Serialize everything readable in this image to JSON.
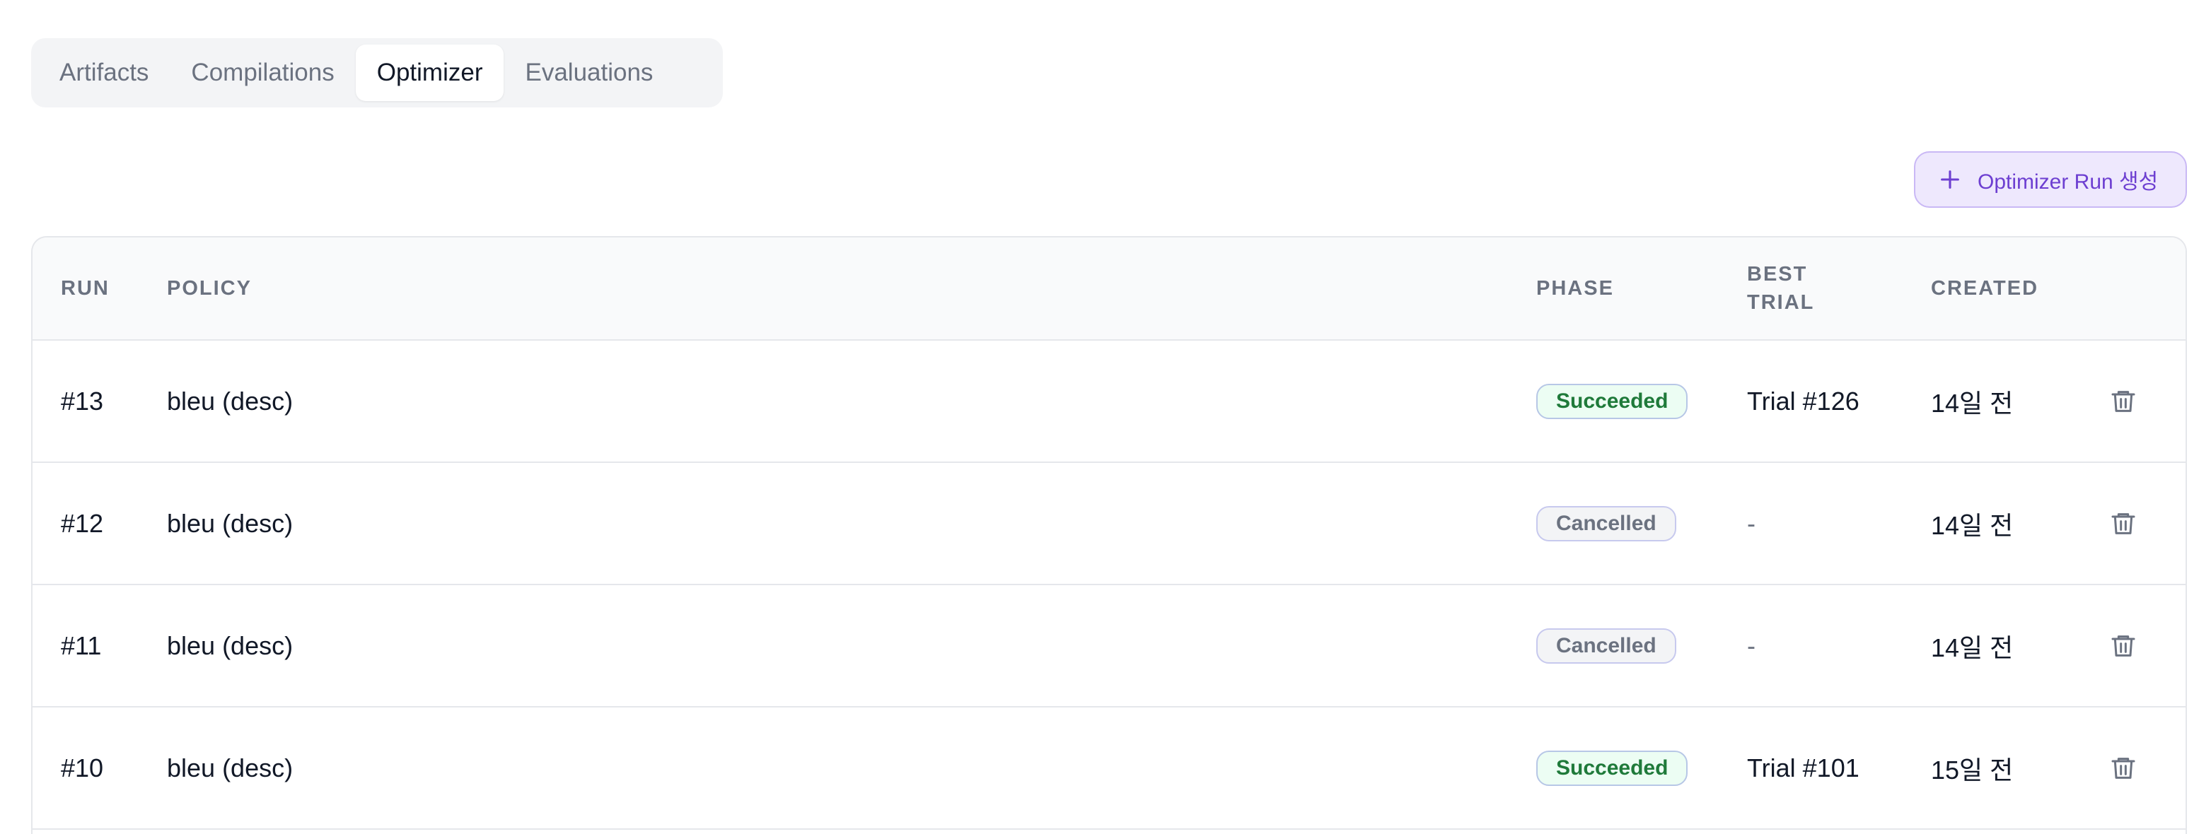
{
  "tabs": [
    {
      "label": "Artifacts",
      "active": false
    },
    {
      "label": "Compilations",
      "active": false
    },
    {
      "label": "Optimizer",
      "active": true
    },
    {
      "label": "Evaluations",
      "active": false
    }
  ],
  "toolbar": {
    "create_label": "Optimizer Run 생성",
    "create_icon": "plus-icon"
  },
  "table": {
    "headers": {
      "run": "RUN",
      "policy": "POLICY",
      "phase": "PHASE",
      "best_trial_line1": "BEST",
      "best_trial_line2": "TRIAL",
      "created": "CREATED"
    },
    "rows": [
      {
        "run": "#13",
        "policy": "bleu (desc)",
        "phase": "Succeeded",
        "best_trial": "Trial #126",
        "created": "14일 전"
      },
      {
        "run": "#12",
        "policy": "bleu (desc)",
        "phase": "Cancelled",
        "best_trial": "-",
        "created": "14일 전"
      },
      {
        "run": "#11",
        "policy": "bleu (desc)",
        "phase": "Cancelled",
        "best_trial": "-",
        "created": "14일 전"
      },
      {
        "run": "#10",
        "policy": "bleu (desc)",
        "phase": "Succeeded",
        "best_trial": "Trial #101",
        "created": "15일 전"
      }
    ],
    "row_action_icon": "trash-icon"
  },
  "colors": {
    "accent": "#6d3fd1",
    "success": "#1f7a3a",
    "muted": "#6b7280"
  }
}
